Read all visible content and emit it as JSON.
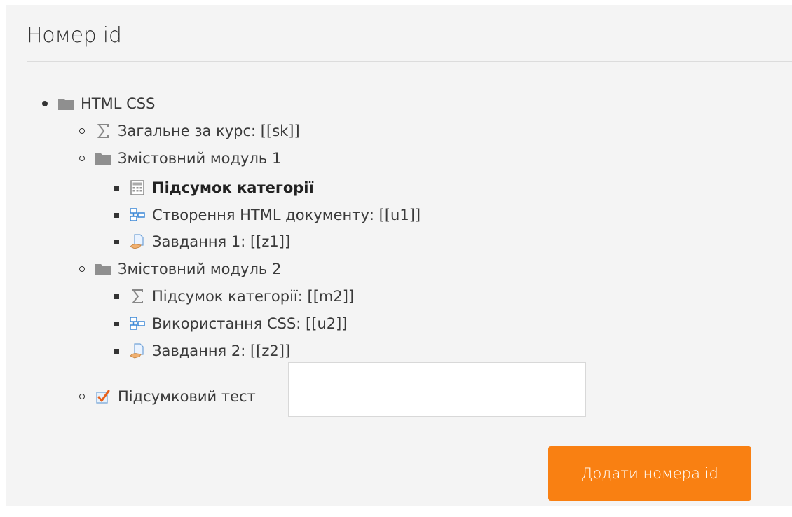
{
  "header": {
    "title": "Номер id"
  },
  "tree": {
    "course": {
      "label": "HTML CSS",
      "icon": "folder-icon"
    },
    "course_total": {
      "label": "Загальне за курс: [[sk]]",
      "icon": "sigma-icon"
    },
    "module1": {
      "label": "Змістовний модуль 1",
      "icon": "folder-icon",
      "items": [
        {
          "label": "Підсумок категорії",
          "icon": "calculator-icon"
        },
        {
          "label": "Створення HTML документу: [[u1]]",
          "icon": "assignment-icon"
        },
        {
          "label": "Завдання 1: [[z1]]",
          "icon": "hand-document-icon"
        }
      ]
    },
    "module2": {
      "label": "Змістовний модуль 2",
      "icon": "folder-icon",
      "items": [
        {
          "label": "Підсумок категорії: [[m2]]",
          "icon": "sigma-icon"
        },
        {
          "label": "Використання CSS: [[u2]]",
          "icon": "assignment-icon"
        },
        {
          "label": "Завдання 2: [[z2]]",
          "icon": "hand-document-icon"
        }
      ]
    },
    "final_test": {
      "label": "Підсумковий тест",
      "icon": "quiz-checkmark-icon",
      "input_value": ""
    }
  },
  "actions": {
    "submit_label": "Додати номера id"
  },
  "colors": {
    "accent": "#f98012",
    "background": "#f4f4f4"
  }
}
